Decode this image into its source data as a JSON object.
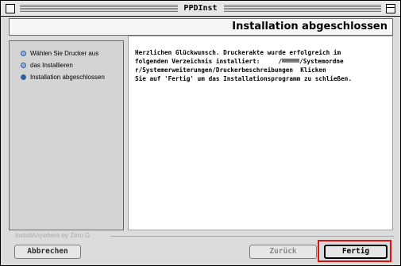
{
  "window": {
    "title": "PPDInst"
  },
  "header": {
    "title": "Installation abgeschlossen"
  },
  "steps": [
    {
      "label": "Wählen Sie Drucker aus",
      "state": "open"
    },
    {
      "label": "das Installieren",
      "state": "open"
    },
    {
      "label": "Installation abgeschlossen",
      "state": "done"
    }
  ],
  "content": {
    "line1": "Herzlichen Glückwunsch. Druckerakte wurde erfolgreich im",
    "line2a": "folgenden Verzeichnis installiert:     /",
    "line2b": "/Systemordne",
    "line3": "r/Systemerweiterungen/Druckerbeschreibungen  Klicken",
    "line4": "Sie auf 'Fertig' um das Installationsprogramm zu schließen."
  },
  "branding": {
    "text": "InstallAnywhere by Zero G"
  },
  "buttons": {
    "cancel": "Abbrechen",
    "back": "Zurück",
    "finish": "Fertig"
  },
  "colors": {
    "highlight": "#e01010",
    "step_done": "#2f5f9e",
    "step_open": "#8fb4e4"
  }
}
